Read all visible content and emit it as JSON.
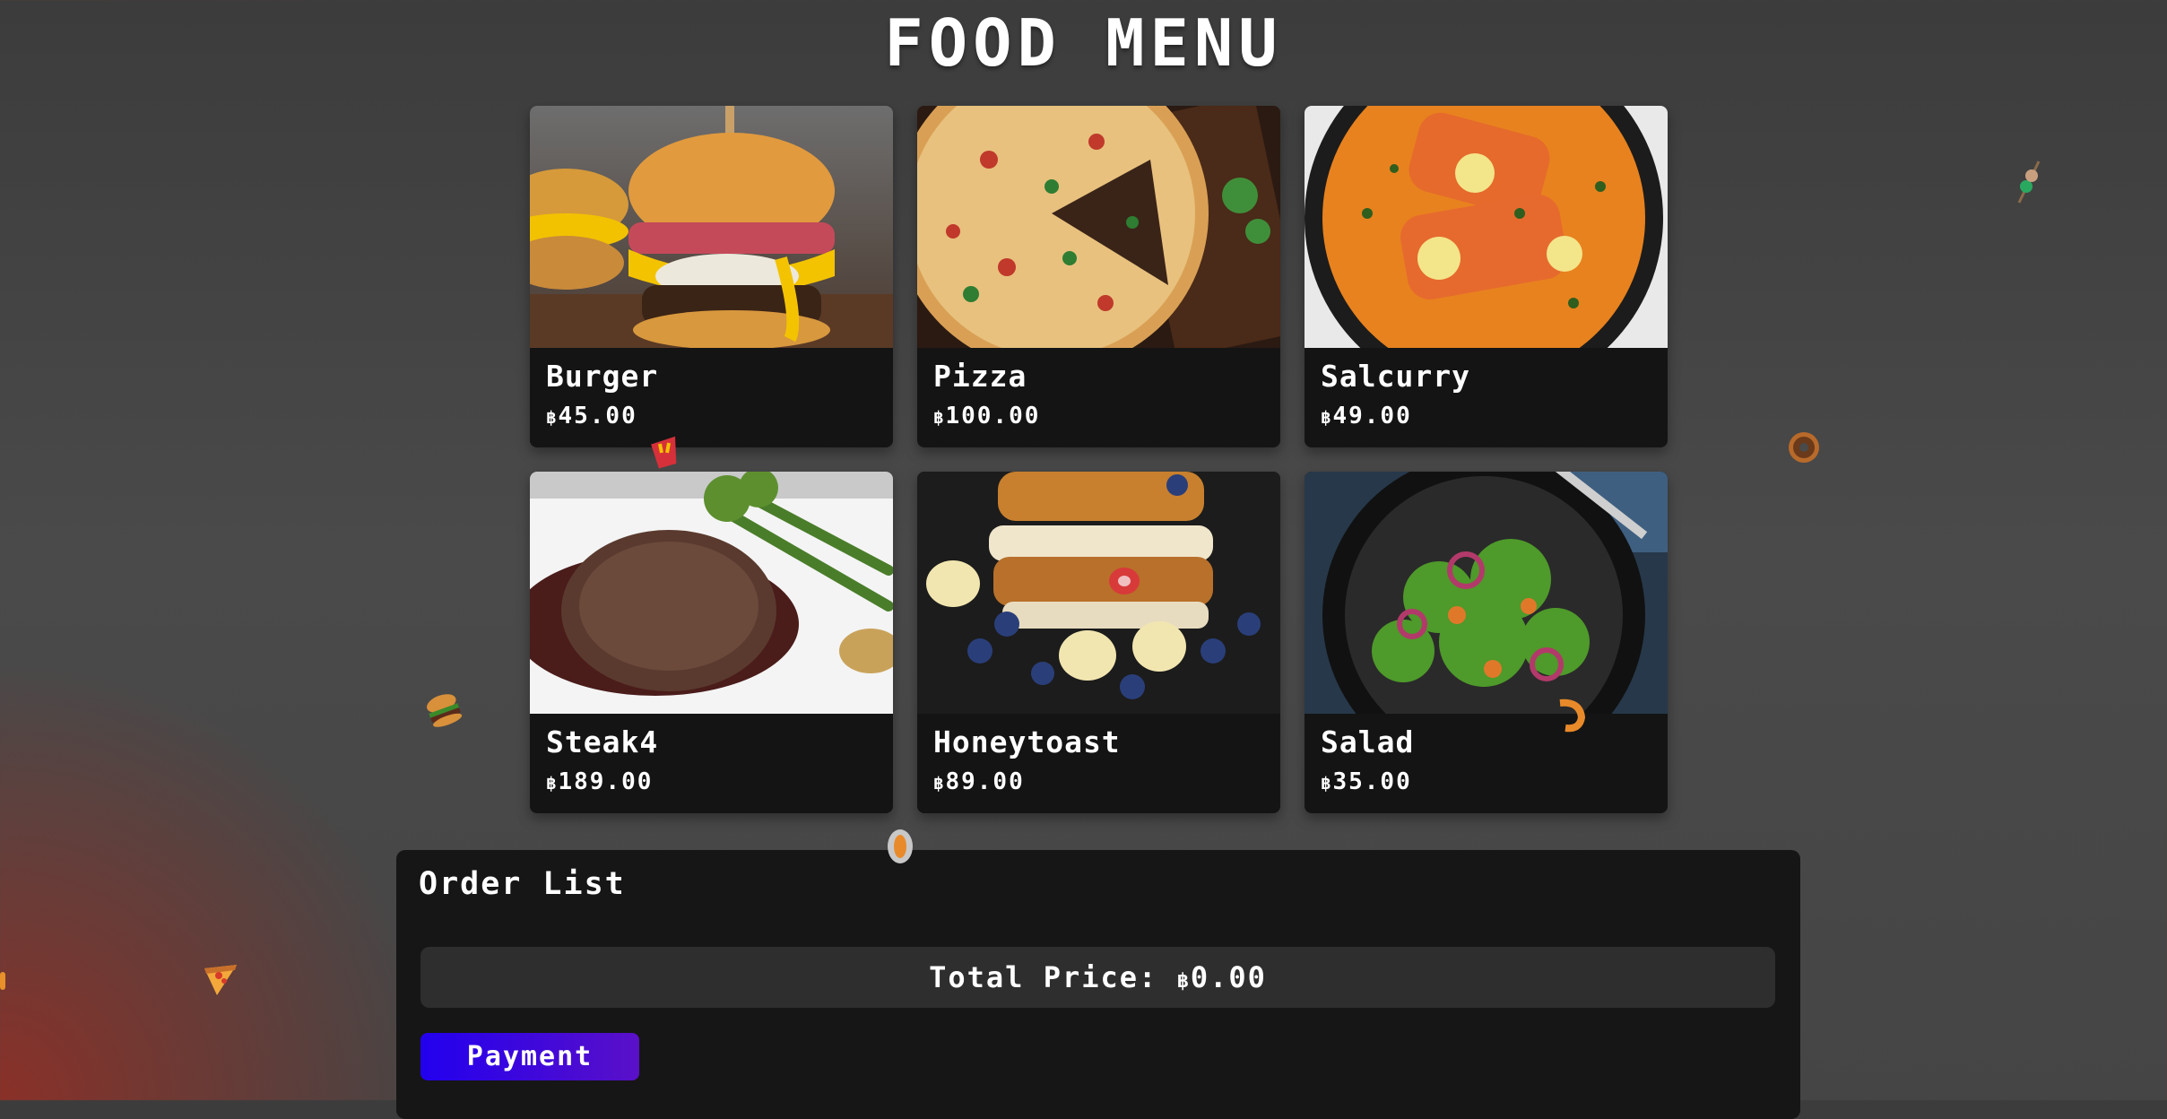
{
  "header": {
    "title": "FOOD MENU"
  },
  "currency_symbol": "฿",
  "menu": {
    "items": [
      {
        "name": "Burger",
        "price": "45.00"
      },
      {
        "name": "Pizza",
        "price": "100.00"
      },
      {
        "name": "Salcurry",
        "price": "49.00"
      },
      {
        "name": "Steak4",
        "price": "189.00"
      },
      {
        "name": "Honeytoast",
        "price": "89.00"
      },
      {
        "name": "Salad",
        "price": "35.00"
      }
    ]
  },
  "order": {
    "heading": "Order List",
    "total_label": "Total Price:",
    "total_value": "0.00",
    "payment_button": "Payment"
  },
  "colors": {
    "background": "#444444",
    "card": "#141414",
    "order_panel": "#161616",
    "payment_gradient_start": "#2200ee",
    "payment_gradient_end": "#5a10c8"
  },
  "decorations": [
    "skewer-icon",
    "donut-icon",
    "fries-icon",
    "meat-icon",
    "burger-icon",
    "pizza-slice-icon",
    "shrimp-icon"
  ]
}
